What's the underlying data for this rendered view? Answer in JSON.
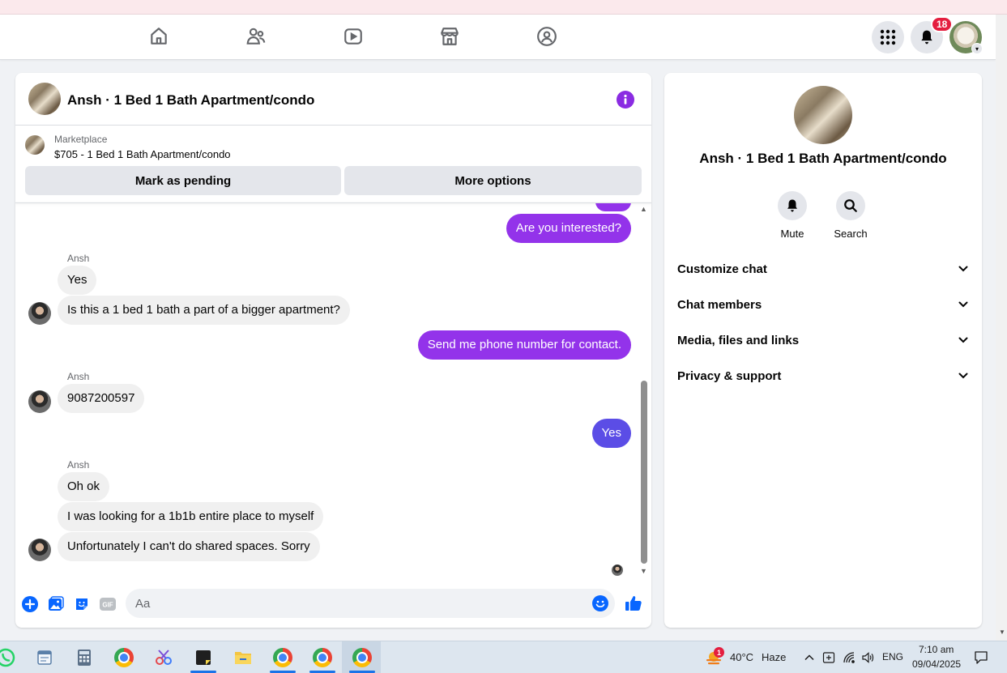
{
  "colors": {
    "accent_purple": "#9333ea",
    "accent_blue_bubble": "#5b4de6",
    "notification_red": "#e41e3f",
    "messenger_blue": "#0866ff"
  },
  "topnav": {
    "icons": [
      "home-icon",
      "friends-icon",
      "video-icon",
      "marketplace-icon",
      "groups-icon"
    ],
    "notification_count": "18"
  },
  "chat": {
    "title": "Ansh · 1 Bed 1 Bath Apartment/condo",
    "marketplace_label": "Marketplace",
    "listing_price_title": "$705 - 1 Bed 1 Bath Apartment/condo",
    "mark_pending_label": "Mark as pending",
    "more_options_label": "More options",
    "messages": [
      {
        "from": "me",
        "text": "Are you interested?"
      },
      {
        "from": "them",
        "sender": "Ansh",
        "text": "Yes"
      },
      {
        "from": "them",
        "text": "Is this a 1 bed 1 bath a part of a bigger apartment?"
      },
      {
        "from": "me",
        "text": "Send me phone number for contact."
      },
      {
        "from": "them",
        "sender": "Ansh",
        "text": "9087200597"
      },
      {
        "from": "me",
        "text": "Yes"
      },
      {
        "from": "them",
        "sender": "Ansh",
        "text": "Oh ok"
      },
      {
        "from": "them",
        "text": "I was looking for a 1b1b entire place to myself"
      },
      {
        "from": "them",
        "text": "Unfortunately I can't do shared spaces. Sorry"
      }
    ],
    "composer_placeholder": "Aa"
  },
  "info_panel": {
    "name": "Ansh · 1 Bed 1 Bath Apartment/condo",
    "mute_label": "Mute",
    "search_label": "Search",
    "sections": [
      "Customize chat",
      "Chat members",
      "Media, files and links",
      "Privacy & support"
    ]
  },
  "taskbar": {
    "weather_badge": "1",
    "temperature": "40°C",
    "weather": "Haze",
    "language": "ENG",
    "time": "7:10 am",
    "date": "09/04/2025"
  }
}
